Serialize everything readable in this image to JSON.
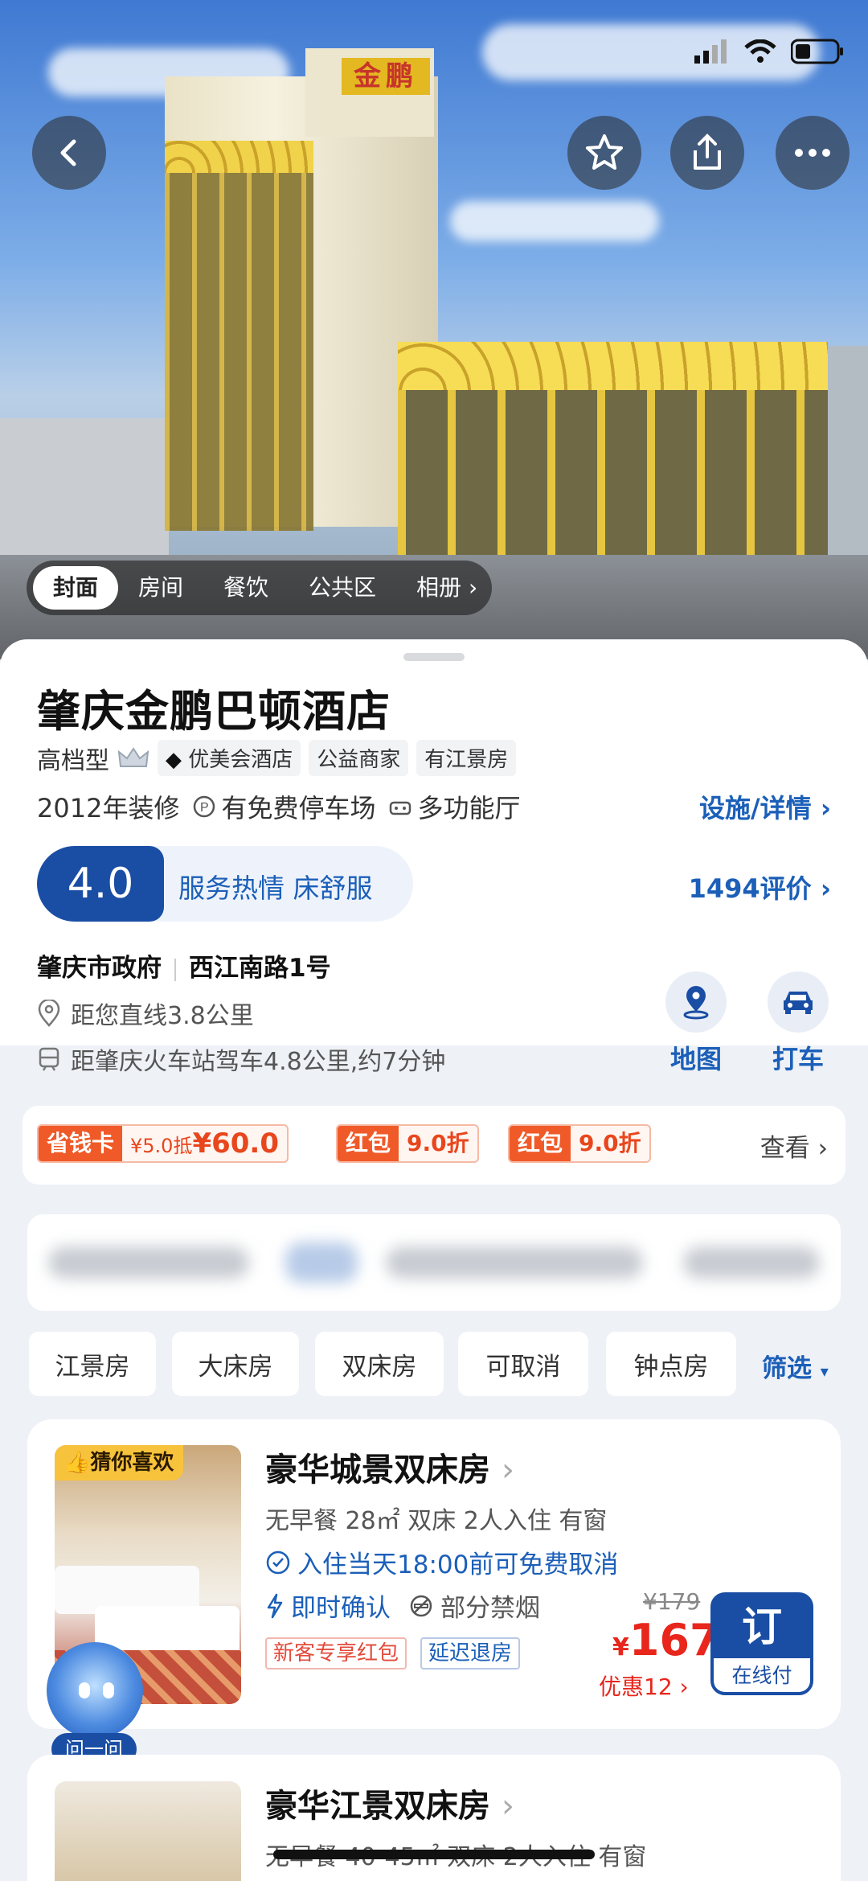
{
  "hero": {
    "photo_tabs": [
      "封面",
      "房间",
      "餐饮",
      "公共区",
      "相册"
    ],
    "active_tab": 0
  },
  "hotel": {
    "name": "肇庆金鹏巴顿酒店",
    "grade": "高档型",
    "tags": [
      "优美会酒店",
      "公益商家",
      "有江景房"
    ],
    "renovated": "2012年装修",
    "parking": "有免费停车场",
    "hall": "多功能厅",
    "facilities_link": "设施/详情",
    "score": "4.0",
    "score_summary": "服务热情 床舒服",
    "reviews_link": "1494评价",
    "area": "肇庆市政府",
    "street": "西江南路1号",
    "distance_you": "距您直线3.8公里",
    "distance_station": "距肇庆火车站驾车4.8公里,约7分钟",
    "map_label": "地图",
    "taxi_label": "打车"
  },
  "coupons": [
    {
      "label": "省钱卡",
      "detail_small": "¥5.0抵",
      "detail": "¥60.0"
    },
    {
      "label": "红包",
      "detail_small": "",
      "detail": "9.0折"
    },
    {
      "label": "红包",
      "detail_small": "",
      "detail": "9.0折"
    }
  ],
  "coupons_more": "查看",
  "room_filters": [
    "江景房",
    "大床房",
    "双床房",
    "可取消",
    "钟点房"
  ],
  "filter_label": "筛选",
  "rooms": [
    {
      "badge": "猜你喜欢",
      "name": "豪华城景双床房",
      "info": "无早餐  28㎡  双床  2人入住  有窗",
      "cancel": "入住当天18:00前可免费取消",
      "confirm": "即时确认",
      "smoke": "部分禁烟",
      "tag_red": "新客专享红包",
      "tag_blue": "延迟退房",
      "old_price": "¥179",
      "currency": "¥",
      "price": "167",
      "discount": "优惠12",
      "book_label": "订",
      "pay_label": "在线付"
    },
    {
      "name": "豪华江景双床房",
      "info": "无早餐  40-45㎡  双床  2人入住  有窗"
    }
  ],
  "assistant_label": "问一问"
}
